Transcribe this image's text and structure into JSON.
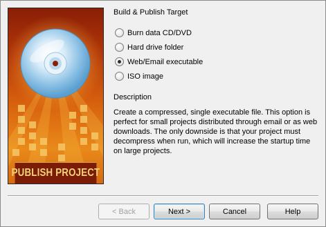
{
  "banner": {
    "caption": "PUBLISH PROJECT"
  },
  "target": {
    "title": "Build & Publish Target",
    "options": [
      {
        "label": "Burn data CD/DVD",
        "checked": false
      },
      {
        "label": "Hard drive folder",
        "checked": false
      },
      {
        "label": "Web/Email executable",
        "checked": true
      },
      {
        "label": "ISO image",
        "checked": false
      }
    ]
  },
  "description": {
    "title": "Description",
    "text": "Create a compressed, single executable file. This option is perfect for small projects distributed through email or as web downloads. The only downside is that your project must decompress when run, which will increase the startup time on large projects."
  },
  "buttons": {
    "back": "< Back",
    "next": "Next >",
    "cancel": "Cancel",
    "help": "Help"
  }
}
